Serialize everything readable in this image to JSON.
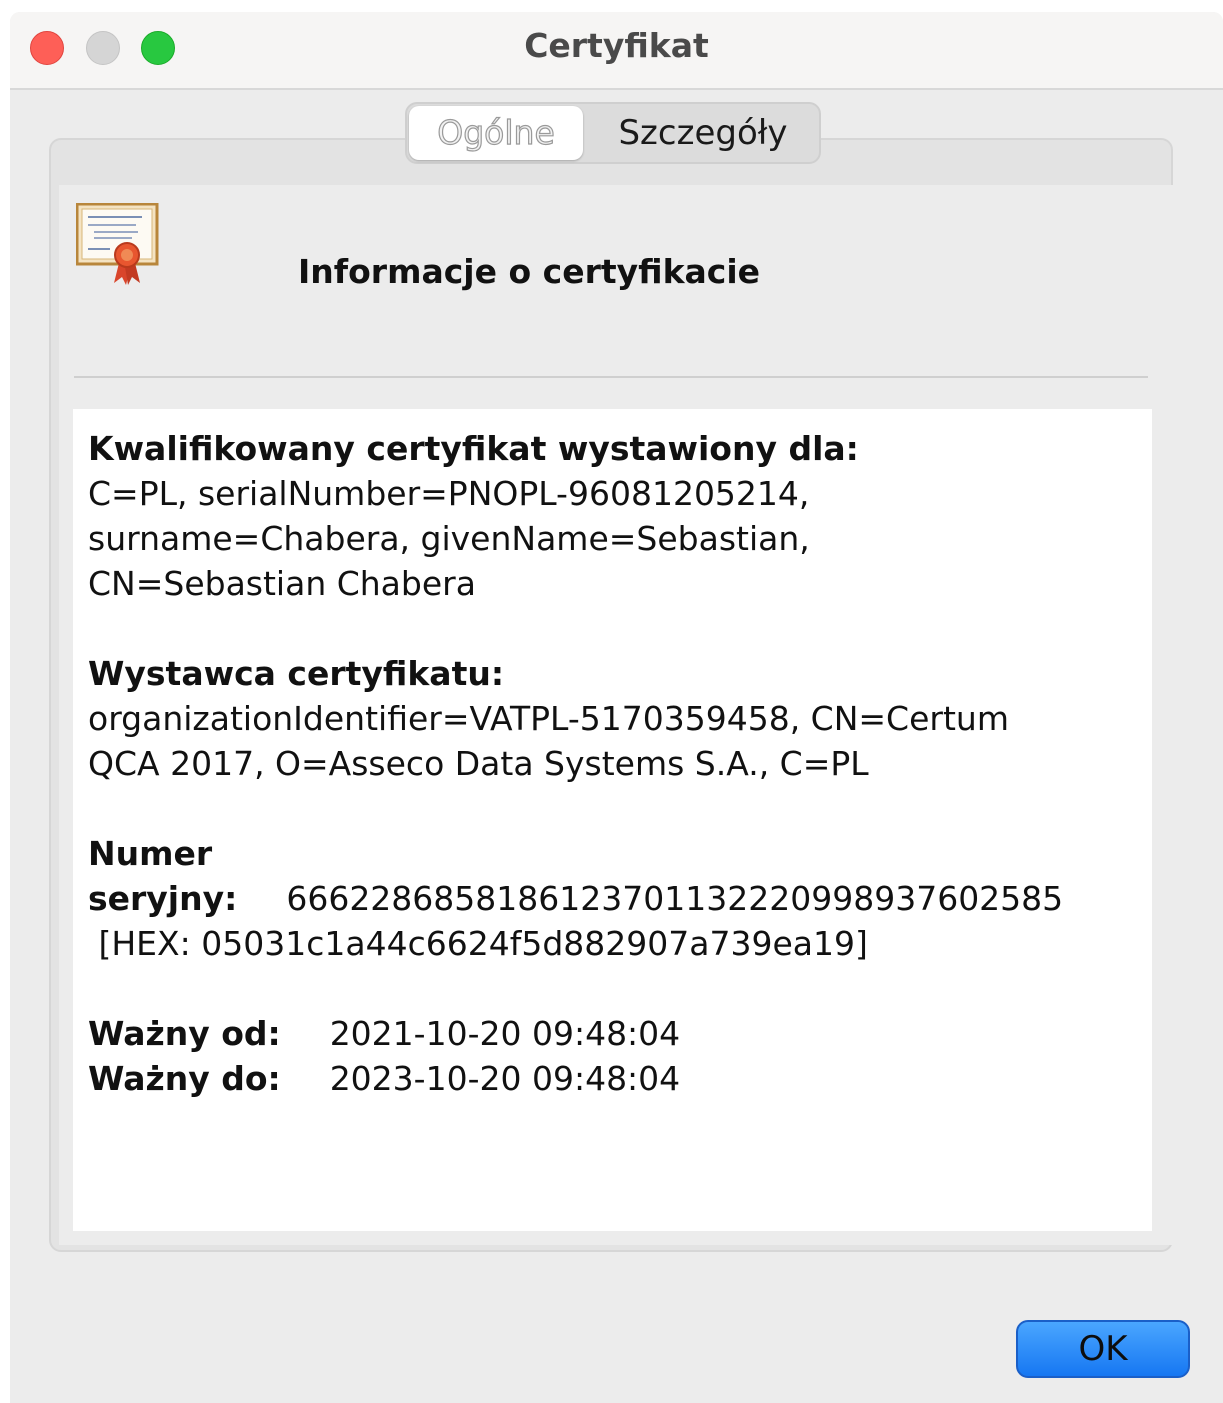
{
  "window": {
    "title": "Certyfikat"
  },
  "tabs": [
    {
      "label": "Ogólne",
      "selected": true
    },
    {
      "label": "Szczegóły",
      "selected": false
    }
  ],
  "header": {
    "icon": "certificate-icon",
    "title": "Informacje o certyfikacie"
  },
  "issued_to": {
    "label": "Kwalifikowany certyfikat wystawiony dla:",
    "lines": [
      "C=PL, serialNumber=PNOPL-96081205214,",
      "surname=Chabera, givenName=Sebastian,",
      "CN=Sebastian Chabera"
    ]
  },
  "issuer": {
    "label": "Wystawca certyfikatu:",
    "lines": [
      "organizationIdentifier=VATPL-5170359458, CN=Certum",
      "QCA 2017, O=Asseco Data Systems S.A., C=PL"
    ]
  },
  "serial": {
    "label_line1": "Numer",
    "label_line2": "seryjny:",
    "value": "6662286858186123701132220998937602585",
    "hex": " [HEX: 05031c1a44c6624f5d882907a739ea19]"
  },
  "validity": {
    "from_label": "Ważny od:",
    "from_value": "2021-10-20 09:48:04",
    "to_label": "Ważny do:",
    "to_value": "2023-10-20 09:48:04"
  },
  "buttons": {
    "ok_label": "OK"
  }
}
